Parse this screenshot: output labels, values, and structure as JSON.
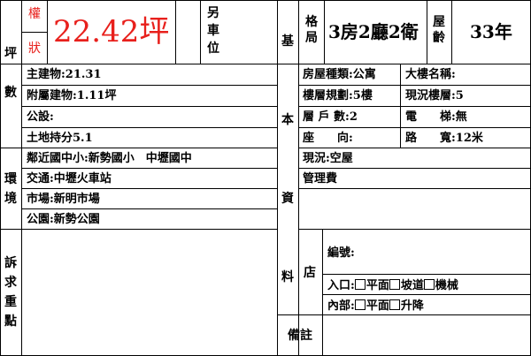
{
  "header": {
    "area_label_1": "權",
    "area_label_2": "狀",
    "area_value": "22.42坪",
    "parking_1": "另",
    "parking_2": "車",
    "parking_3": "位",
    "layout_label_1": "格",
    "layout_label_2": "局",
    "layout_value": "3房2廳2衛",
    "age_label_1": "屋",
    "age_label_2": "齡",
    "age_value": "33年"
  },
  "left_sections": {
    "ping": [
      "坪",
      "數"
    ],
    "environment": [
      "環",
      "境"
    ],
    "appeal": [
      "訴",
      "求",
      "重",
      "點"
    ]
  },
  "ping_rows": {
    "main_building": "主建物:21.31",
    "attached_building": "附屬建物:1.11坪",
    "public_facility": "公設:",
    "land_share": "土地持分5.1"
  },
  "environment_rows": {
    "school": "鄰近國中小:新勢國小　中壢國中",
    "transport": "交通:中壢火車站",
    "market": "市場:新明市場",
    "park": "公園:新勢公園"
  },
  "middle_label": [
    "基",
    "本",
    "資",
    "料"
  ],
  "basic": {
    "house_type": "房屋種類:公寓",
    "building_name": "大樓名稱:",
    "floor_plan": "樓層規劃:5樓",
    "current_floor": "現況樓層:5",
    "units_label": "層 戶 數:2",
    "elevator": "電　　梯:無",
    "orientation": "座　　向:",
    "road_width": "路　　寬:12米",
    "status": "現況:空屋",
    "management_fee": "管理費"
  },
  "shop": {
    "label": "店",
    "number": "編號:",
    "entrance_prefix": "入口:",
    "entrance_options": [
      "平面",
      "坡道",
      "機械"
    ],
    "interior_prefix": "內部:",
    "interior_options": [
      "平面",
      "升降"
    ]
  },
  "remarks": {
    "label": "備註"
  }
}
